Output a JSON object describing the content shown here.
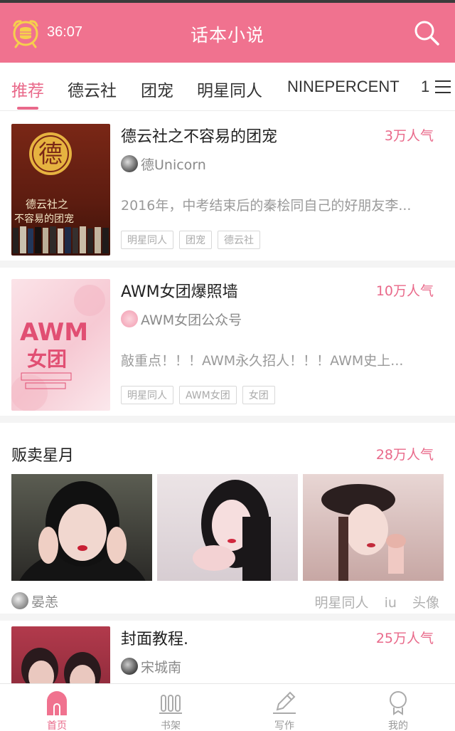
{
  "header": {
    "timer": "36:07",
    "title": "话本小说"
  },
  "tabs": [
    {
      "label": "推荐",
      "active": true
    },
    {
      "label": "德云社"
    },
    {
      "label": "团宠"
    },
    {
      "label": "明星同人"
    },
    {
      "label": "NINEPERCENT"
    },
    {
      "label": "1"
    }
  ],
  "feed": {
    "stories": [
      {
        "title": "德云社之不容易的团宠",
        "popularity": "3万人气",
        "author": "德Unicorn",
        "description": "2016年，中考结束后的秦桧同自己的好朋友李...",
        "tags": [
          "明星同人",
          "团宠",
          "德云社"
        ]
      },
      {
        "title": "AWM女团爆照墙",
        "popularity": "10万人气",
        "author": "AWM女团公众号",
        "description": "敲重点！！！AWM永久招人！！！AWM史上...",
        "tags": [
          "明星同人",
          "AWM女团",
          "女团"
        ]
      }
    ],
    "gallery": {
      "title": "贩卖星月",
      "popularity": "28万人气",
      "author": "晏恙",
      "tags": [
        "明星同人",
        "iu",
        "头像"
      ]
    },
    "story3": {
      "title": "封面教程.",
      "popularity": "25万人气",
      "author": "宋城南"
    },
    "cover_texts": {
      "c1_seal": "德",
      "c1_line1": "德云社之",
      "c1_line2": "不容易的团宠",
      "c2_big": "AWM",
      "c2_mid": "女团"
    }
  },
  "bottom_nav": [
    {
      "label": "首页",
      "active": true
    },
    {
      "label": "书架"
    },
    {
      "label": "写作"
    },
    {
      "label": "我的"
    }
  ],
  "colors": {
    "brand": "#f0728f",
    "accent": "#e9698a"
  }
}
